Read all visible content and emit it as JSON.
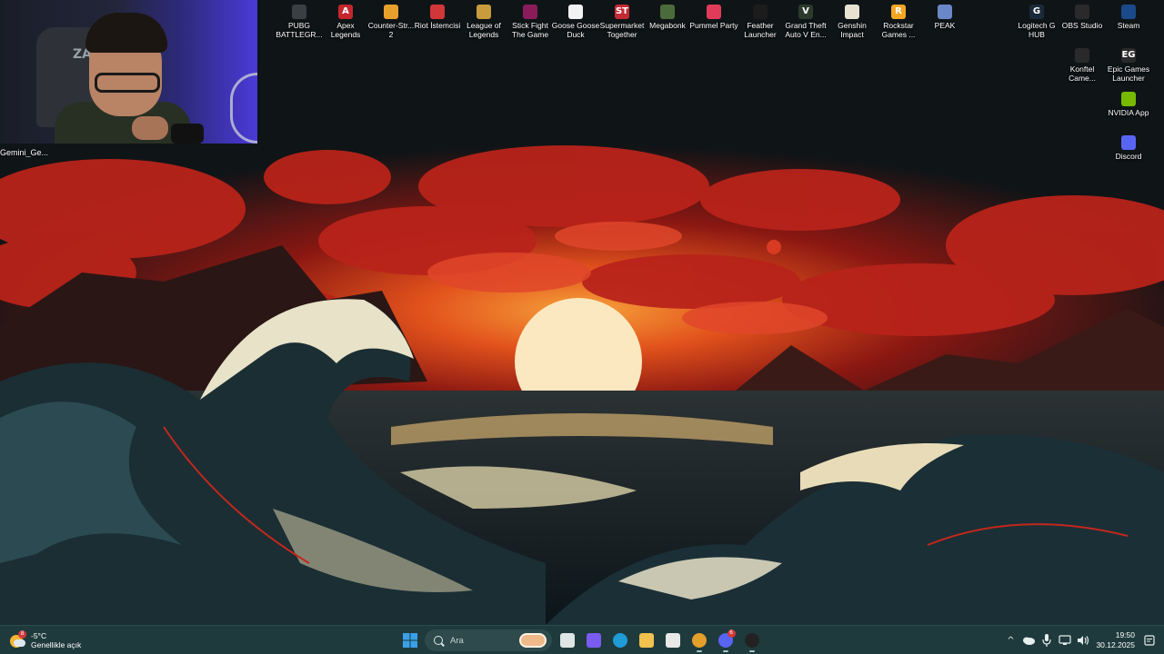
{
  "webcam": {
    "label": "Gemini_Ge...",
    "chair_logo": "ZA"
  },
  "desktop_icons": [
    {
      "name": "pubg",
      "label": "PUBG BATTLEGR...",
      "icon": "pubg-icon",
      "color": "#3a3f44",
      "glyph": ""
    },
    {
      "name": "apex",
      "label": "Apex Legends",
      "icon": "apex-icon",
      "color": "#c4262e",
      "glyph": "A"
    },
    {
      "name": "counter-strike",
      "label": "Counter-Str... 2",
      "icon": "counter-strike-icon",
      "color": "#e7a02c",
      "glyph": ""
    },
    {
      "name": "riot",
      "label": "Riot İstemcisi",
      "icon": "riot-icon",
      "color": "#d13639",
      "glyph": ""
    },
    {
      "name": "lol",
      "label": "League of Legends",
      "icon": "league-icon",
      "color": "#c89b3c",
      "glyph": ""
    },
    {
      "name": "stick-fight",
      "label": "Stick Fight The Game",
      "icon": "stick-fight-icon",
      "color": "#8b1c5a",
      "glyph": ""
    },
    {
      "name": "goose",
      "label": "Goose Goose Duck",
      "icon": "goose-icon",
      "color": "#f2f2f2",
      "glyph": ""
    },
    {
      "name": "supermarket",
      "label": "Supermarket Together",
      "icon": "supermarket-icon",
      "color": "#c42a34",
      "glyph": "ST"
    },
    {
      "name": "megabonk",
      "label": "Megabonk",
      "icon": "megabonk-icon",
      "color": "#4b6b3a",
      "glyph": ""
    },
    {
      "name": "pummel",
      "label": "Pummel Party",
      "icon": "pummel-party-icon",
      "color": "#e03c5a",
      "glyph": ""
    },
    {
      "name": "feather",
      "label": "Feather Launcher",
      "icon": "feather-icon",
      "color": "#1c1c1c",
      "glyph": ""
    },
    {
      "name": "gta",
      "label": "Grand Theft Auto V En...",
      "icon": "gta-icon",
      "color": "#2c3a2c",
      "glyph": "V"
    },
    {
      "name": "genshin",
      "label": "Genshin Impact",
      "icon": "genshin-icon",
      "color": "#e9e2d2",
      "glyph": ""
    },
    {
      "name": "rockstar",
      "label": "Rockstar Games ...",
      "icon": "rockstar-icon",
      "color": "#f5a623",
      "glyph": "R"
    },
    {
      "name": "peak",
      "label": "PEAK",
      "icon": "peak-icon",
      "color": "#6a88c8",
      "glyph": ""
    },
    {
      "name": "logitech",
      "label": "Logitech G HUB",
      "icon": "logitech-icon",
      "color": "#1a2a3a",
      "glyph": "G"
    },
    {
      "name": "obs",
      "label": "OBS Studio",
      "icon": "obs-icon",
      "color": "#2a2a2a",
      "glyph": ""
    },
    {
      "name": "steam",
      "label": "Steam",
      "icon": "steam-icon",
      "color": "#1b4a8a",
      "glyph": ""
    },
    {
      "name": "konftel",
      "label": "Konftel Came...",
      "icon": "konftel-icon",
      "color": "#2a2a2a",
      "glyph": ""
    },
    {
      "name": "epic",
      "label": "Epic Games Launcher",
      "icon": "epic-games-icon",
      "color": "#2a2a2a",
      "glyph": "EG"
    },
    {
      "name": "nvidia",
      "label": "NVIDIA App",
      "icon": "nvidia-icon",
      "color": "#76b900",
      "glyph": ""
    },
    {
      "name": "discord-desk",
      "label": "Discord",
      "icon": "discord-icon",
      "color": "#5865f2",
      "glyph": ""
    }
  ],
  "taskbar": {
    "weather": {
      "temp": "-5°C",
      "condition": "Genellikle açık",
      "badge": "8"
    },
    "search": {
      "placeholder": "Ara"
    },
    "apps": [
      {
        "name": "start",
        "icon": "windows-start-icon",
        "color": "#3aa0e8",
        "glyph": "",
        "running": false,
        "count": ""
      },
      {
        "name": "search",
        "icon": "search-icon"
      },
      {
        "name": "task-view",
        "icon": "task-view-icon",
        "color": "#dfe5e5",
        "glyph": "",
        "running": false,
        "count": ""
      },
      {
        "name": "copilot",
        "icon": "copilot-icon",
        "color": "#7a5cf0",
        "glyph": "",
        "running": false,
        "count": ""
      },
      {
        "name": "edge",
        "icon": "edge-icon",
        "color": "#1f9bd6",
        "glyph": "",
        "running": false,
        "count": ""
      },
      {
        "name": "file-explorer",
        "icon": "folder-icon",
        "color": "#f2c14e",
        "glyph": "",
        "running": false,
        "count": ""
      },
      {
        "name": "store",
        "icon": "store-icon",
        "color": "#e8e8e8",
        "glyph": "",
        "running": false,
        "count": ""
      },
      {
        "name": "chrome",
        "icon": "chrome-icon",
        "color": "#e2a02a",
        "glyph": "",
        "running": true,
        "count": ""
      },
      {
        "name": "discord",
        "icon": "discord-icon",
        "color": "#5865f2",
        "glyph": "",
        "running": true,
        "count": "6"
      },
      {
        "name": "obs",
        "icon": "obs-icon",
        "color": "#222222",
        "glyph": "",
        "running": true,
        "count": ""
      }
    ],
    "tray": {
      "chevron": "^",
      "icons": [
        "onedrive-icon",
        "microphone-icon",
        "network-icon",
        "volume-icon"
      ],
      "time": "19:50",
      "date": "30.12.2025"
    }
  },
  "colors": {
    "taskbar_bg": "#1f3a3c",
    "sky_red": "#c5281c",
    "sun": "#fbe8c0",
    "wave_dark": "#12232a",
    "wave_foam": "#e8e2c8"
  }
}
